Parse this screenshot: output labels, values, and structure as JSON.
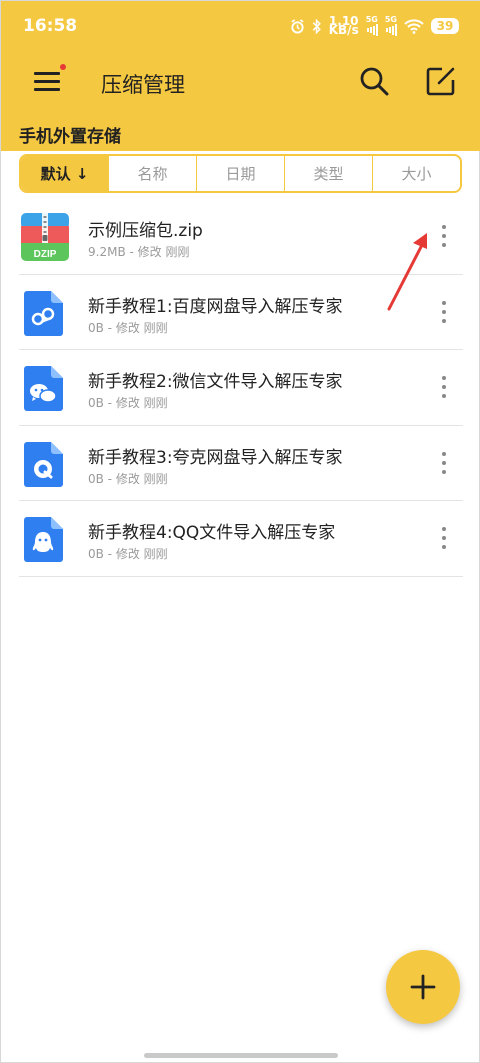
{
  "status_bar": {
    "time": "16:58",
    "speed_value": "1.10",
    "speed_unit": "KB/s",
    "signal1_label": "5G",
    "signal2_label": "5G",
    "battery": "39"
  },
  "header": {
    "title": "压缩管理",
    "icons": [
      "menu-icon",
      "search-icon",
      "edit-icon"
    ],
    "menu_has_notification": true
  },
  "storage_label": "手机外置存储",
  "sort_tabs": [
    {
      "label": "默认 ↓",
      "selected": true
    },
    {
      "label": "名称",
      "selected": false
    },
    {
      "label": "日期",
      "selected": false
    },
    {
      "label": "类型",
      "selected": false
    },
    {
      "label": "大小",
      "selected": false
    }
  ],
  "files": [
    {
      "name": "示例压缩包.zip",
      "meta": "9.2MB - 修改 刚刚",
      "icon": "zip-archive-icon",
      "icon_label": "DZIP"
    },
    {
      "name": "新手教程1:百度网盘导入解压专家",
      "meta": "0B - 修改 刚刚",
      "icon": "baidu-netdisk-doc-icon"
    },
    {
      "name": "新手教程2:微信文件导入解压专家",
      "meta": "0B - 修改 刚刚",
      "icon": "wechat-doc-icon"
    },
    {
      "name": "新手教程3:夸克网盘导入解压专家",
      "meta": "0B - 修改 刚刚",
      "icon": "quark-doc-icon"
    },
    {
      "name": "新手教程4:QQ文件导入解压专家",
      "meta": "0B - 修改 刚刚",
      "icon": "qq-doc-icon"
    }
  ],
  "fab_icon": "plus-icon",
  "colors": {
    "accent": "#f5c842",
    "doc_blue": "#2f7ff0",
    "annotation_red": "#e53935"
  }
}
